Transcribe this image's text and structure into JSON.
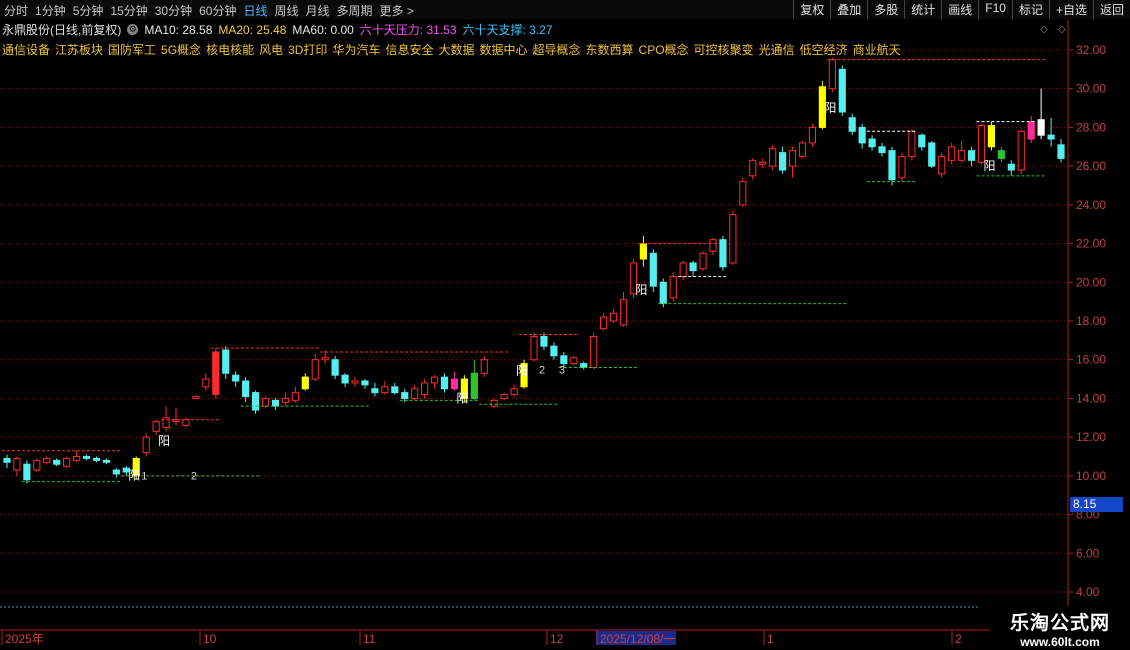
{
  "toolbar": {
    "tabs": [
      "分时",
      "1分钟",
      "5分钟",
      "15分钟",
      "30分钟",
      "60分钟",
      "日线",
      "周线",
      "月线",
      "多周期",
      "更多 >"
    ],
    "active_tab": "日线",
    "right_buttons": [
      "复权",
      "叠加",
      "多股",
      "统计",
      "画线",
      "F10",
      "标记",
      "+自选",
      "返回"
    ]
  },
  "info": {
    "title": "永鼎股份(日线,前复权)",
    "ma10": "MA10: 28.58",
    "ma20": "MA20: 25.48",
    "ma60": "MA60: 0.00",
    "pressure": "六十天压力: 31.53",
    "support": "六十天支撑: 3.27"
  },
  "concepts": [
    "通信设备",
    "江苏板块",
    "国防军工",
    "5G概念",
    "核电核能",
    "风电",
    "3D打印",
    "华为汽车",
    "信息安全",
    "大数据",
    "数据中心",
    "超导概念",
    "东数西算",
    "CPO概念",
    "可控核聚变",
    "光通信",
    "低空经济",
    "商业航天"
  ],
  "colors": {
    "up_candle": "#ff2a2a",
    "down_candle": "#54f0f0",
    "yellow": "#ffff00",
    "magenta": "#ff2a9a",
    "green": "#2ec42e",
    "grid": "#8b1a1a",
    "ma10": "#ffffff",
    "ma20": "#f0d040",
    "pressure": "#ff50ff",
    "support": "#40c0ff"
  },
  "axis": {
    "y_labels": [
      "32.00",
      "30.00",
      "28.00",
      "26.00",
      "24.00",
      "22.00",
      "20.00",
      "18.00",
      "16.00",
      "14.00",
      "12.00",
      "10.00",
      "8.00",
      "6.00",
      "4.00"
    ],
    "y_values": [
      32,
      30,
      28,
      26,
      24,
      22,
      20,
      18,
      16,
      14,
      12,
      10,
      8,
      6,
      4
    ],
    "current_price": "8.15",
    "date_labels": [
      "2025年",
      "10",
      "11",
      "12",
      "2025/12/08/一",
      "1",
      "2"
    ]
  },
  "annotations": {
    "yang": "阳",
    "nums": [
      "1",
      "2",
      "2",
      "3"
    ]
  },
  "watermark": {
    "line1": "乐淘公式网",
    "line2": "www.60lt.com"
  },
  "chart_data": {
    "type": "candlestick",
    "ylim": [
      4,
      32
    ],
    "candles": [
      {
        "o": 10.9,
        "c": 10.7,
        "h": 11.1,
        "l": 10.4
      },
      {
        "o": 10.3,
        "c": 10.9,
        "h": 11.0,
        "l": 10.0
      },
      {
        "o": 10.6,
        "c": 9.8,
        "h": 10.8,
        "l": 9.6
      },
      {
        "o": 10.3,
        "c": 10.8,
        "h": 10.9,
        "l": 10.2
      },
      {
        "o": 10.7,
        "c": 10.9,
        "h": 11.0,
        "l": 10.6
      },
      {
        "o": 10.8,
        "c": 10.6,
        "h": 10.9,
        "l": 10.5
      },
      {
        "o": 10.5,
        "c": 10.9,
        "h": 11.0,
        "l": 10.4
      },
      {
        "o": 10.8,
        "c": 11.0,
        "h": 11.3,
        "l": 10.7
      },
      {
        "o": 11.0,
        "c": 10.9,
        "h": 11.1,
        "l": 10.8
      },
      {
        "o": 10.9,
        "c": 10.8,
        "h": 11.0,
        "l": 10.7
      },
      {
        "o": 10.8,
        "c": 10.7,
        "h": 10.9,
        "l": 10.6
      },
      {
        "o": 10.3,
        "c": 10.1,
        "h": 10.4,
        "l": 9.9
      },
      {
        "o": 10.4,
        "c": 10.2,
        "h": 10.5,
        "l": 10.0
      },
      {
        "o": 10.0,
        "c": 10.9,
        "h": 11.0,
        "l": 9.8
      },
      {
        "o": 11.2,
        "c": 12.0,
        "h": 12.2,
        "l": 11.0
      },
      {
        "o": 12.3,
        "c": 12.8,
        "h": 12.9,
        "l": 12.1
      },
      {
        "o": 12.5,
        "c": 13.0,
        "h": 13.6,
        "l": 12.3
      },
      {
        "o": 12.8,
        "c": 12.9,
        "h": 13.5,
        "l": 12.6
      },
      {
        "o": 12.6,
        "c": 12.9,
        "h": 13.0,
        "l": 12.5
      },
      {
        "o": 14.0,
        "c": 14.1,
        "h": 14.2,
        "l": 14.0
      },
      {
        "o": 14.6,
        "c": 15.0,
        "h": 15.3,
        "l": 14.4
      },
      {
        "o": 14.2,
        "c": 16.4,
        "h": 16.6,
        "l": 14.0
      },
      {
        "o": 16.5,
        "c": 15.3,
        "h": 16.7,
        "l": 15.0
      },
      {
        "o": 15.2,
        "c": 14.9,
        "h": 15.4,
        "l": 14.6
      },
      {
        "o": 14.9,
        "c": 14.1,
        "h": 15.1,
        "l": 13.8
      },
      {
        "o": 14.3,
        "c": 13.4,
        "h": 14.4,
        "l": 13.2
      },
      {
        "o": 13.6,
        "c": 14.0,
        "h": 14.1,
        "l": 13.5
      },
      {
        "o": 13.9,
        "c": 13.6,
        "h": 14.0,
        "l": 13.4
      },
      {
        "o": 13.8,
        "c": 14.0,
        "h": 14.3,
        "l": 13.6
      },
      {
        "o": 13.9,
        "c": 14.3,
        "h": 14.6,
        "l": 13.8
      },
      {
        "o": 14.5,
        "c": 15.1,
        "h": 15.3,
        "l": 14.4
      },
      {
        "o": 15.0,
        "c": 16.0,
        "h": 16.3,
        "l": 14.9
      },
      {
        "o": 16.0,
        "c": 16.1,
        "h": 16.5,
        "l": 15.8
      },
      {
        "o": 16.0,
        "c": 15.2,
        "h": 16.2,
        "l": 15.0
      },
      {
        "o": 15.2,
        "c": 14.8,
        "h": 15.3,
        "l": 14.6
      },
      {
        "o": 14.8,
        "c": 14.9,
        "h": 15.1,
        "l": 14.6
      },
      {
        "o": 14.9,
        "c": 14.7,
        "h": 15.0,
        "l": 14.5
      },
      {
        "o": 14.5,
        "c": 14.3,
        "h": 14.8,
        "l": 14.1
      },
      {
        "o": 14.3,
        "c": 14.6,
        "h": 14.9,
        "l": 14.2
      },
      {
        "o": 14.6,
        "c": 14.3,
        "h": 14.8,
        "l": 14.2
      },
      {
        "o": 14.3,
        "c": 14.0,
        "h": 14.5,
        "l": 13.8
      },
      {
        "o": 14.0,
        "c": 14.5,
        "h": 14.7,
        "l": 13.9
      },
      {
        "o": 14.2,
        "c": 14.8,
        "h": 15.0,
        "l": 14.0
      },
      {
        "o": 14.8,
        "c": 15.1,
        "h": 15.2,
        "l": 14.5
      },
      {
        "o": 15.1,
        "c": 14.5,
        "h": 15.3,
        "l": 14.3
      },
      {
        "o": 14.5,
        "c": 15.0,
        "h": 15.4,
        "l": 14.4
      },
      {
        "o": 15.0,
        "c": 14.0,
        "h": 15.2,
        "l": 13.8
      },
      {
        "o": 14.0,
        "c": 15.3,
        "h": 16.0,
        "l": 13.9
      },
      {
        "o": 15.3,
        "c": 16.0,
        "h": 16.2,
        "l": 15.1
      },
      {
        "o": 13.6,
        "c": 13.9,
        "h": 14.0,
        "l": 13.5
      },
      {
        "o": 14.0,
        "c": 14.2,
        "h": 14.3,
        "l": 13.9
      },
      {
        "o": 14.2,
        "c": 14.5,
        "h": 14.7,
        "l": 14.1
      },
      {
        "o": 14.6,
        "c": 15.8,
        "h": 16.0,
        "l": 14.5
      },
      {
        "o": 16.0,
        "c": 17.2,
        "h": 17.4,
        "l": 15.9
      },
      {
        "o": 17.2,
        "c": 16.7,
        "h": 17.4,
        "l": 16.5
      },
      {
        "o": 16.7,
        "c": 16.2,
        "h": 16.9,
        "l": 16.0
      },
      {
        "o": 16.2,
        "c": 15.8,
        "h": 16.4,
        "l": 15.6
      },
      {
        "o": 15.8,
        "c": 16.1,
        "h": 16.2,
        "l": 15.7
      },
      {
        "o": 15.8,
        "c": 15.6,
        "h": 15.9,
        "l": 15.5
      },
      {
        "o": 15.6,
        "c": 17.2,
        "h": 17.4,
        "l": 15.5
      },
      {
        "o": 17.6,
        "c": 18.2,
        "h": 18.4,
        "l": 17.5
      },
      {
        "o": 18.0,
        "c": 18.4,
        "h": 18.6,
        "l": 17.9
      },
      {
        "o": 17.8,
        "c": 19.1,
        "h": 19.5,
        "l": 17.7
      },
      {
        "o": 19.4,
        "c": 21.0,
        "h": 21.2,
        "l": 19.2
      },
      {
        "o": 21.2,
        "c": 22.0,
        "h": 22.4,
        "l": 20.8
      },
      {
        "o": 21.5,
        "c": 19.8,
        "h": 21.7,
        "l": 19.5
      },
      {
        "o": 20.0,
        "c": 18.9,
        "h": 20.2,
        "l": 18.7
      },
      {
        "o": 19.2,
        "c": 20.3,
        "h": 20.5,
        "l": 19.0
      },
      {
        "o": 20.3,
        "c": 21.0,
        "h": 21.1,
        "l": 20.1
      },
      {
        "o": 21.0,
        "c": 20.6,
        "h": 21.1,
        "l": 20.3
      },
      {
        "o": 20.7,
        "c": 21.5,
        "h": 21.6,
        "l": 20.6
      },
      {
        "o": 21.6,
        "c": 22.2,
        "h": 22.3,
        "l": 21.4
      },
      {
        "o": 22.2,
        "c": 20.8,
        "h": 22.4,
        "l": 20.6
      },
      {
        "o": 21.0,
        "c": 23.5,
        "h": 23.7,
        "l": 20.9
      },
      {
        "o": 24.0,
        "c": 25.2,
        "h": 25.4,
        "l": 23.9
      },
      {
        "o": 25.5,
        "c": 26.3,
        "h": 26.4,
        "l": 25.3
      },
      {
        "o": 26.1,
        "c": 26.2,
        "h": 26.4,
        "l": 25.9
      },
      {
        "o": 26.0,
        "c": 26.9,
        "h": 27.1,
        "l": 25.8
      },
      {
        "o": 26.7,
        "c": 25.8,
        "h": 27.0,
        "l": 25.6
      },
      {
        "o": 26.0,
        "c": 26.8,
        "h": 27.0,
        "l": 25.4
      },
      {
        "o": 26.5,
        "c": 27.2,
        "h": 27.3,
        "l": 26.4
      },
      {
        "o": 27.2,
        "c": 28.0,
        "h": 28.2,
        "l": 27.0
      },
      {
        "o": 28.0,
        "c": 30.1,
        "h": 30.4,
        "l": 27.9
      },
      {
        "o": 30.0,
        "c": 31.5,
        "h": 31.6,
        "l": 29.8
      },
      {
        "o": 31.0,
        "c": 28.8,
        "h": 31.2,
        "l": 28.6
      },
      {
        "o": 28.5,
        "c": 27.8,
        "h": 28.7,
        "l": 27.6
      },
      {
        "o": 28.0,
        "c": 27.2,
        "h": 28.2,
        "l": 26.9
      },
      {
        "o": 27.4,
        "c": 27.0,
        "h": 27.6,
        "l": 26.8
      },
      {
        "o": 27.0,
        "c": 26.7,
        "h": 27.2,
        "l": 26.5
      },
      {
        "o": 26.8,
        "c": 25.3,
        "h": 27.0,
        "l": 25.0
      },
      {
        "o": 25.4,
        "c": 26.5,
        "h": 26.7,
        "l": 25.2
      },
      {
        "o": 26.5,
        "c": 27.8,
        "h": 27.9,
        "l": 26.3
      },
      {
        "o": 27.6,
        "c": 27.0,
        "h": 27.7,
        "l": 26.8
      },
      {
        "o": 27.2,
        "c": 26.0,
        "h": 27.3,
        "l": 25.9
      },
      {
        "o": 25.6,
        "c": 26.5,
        "h": 26.7,
        "l": 25.4
      },
      {
        "o": 26.3,
        "c": 27.0,
        "h": 27.2,
        "l": 26.1
      },
      {
        "o": 26.3,
        "c": 26.8,
        "h": 27.3,
        "l": 26.2
      },
      {
        "o": 26.8,
        "c": 26.3,
        "h": 27.0,
        "l": 26.0
      },
      {
        "o": 26.2,
        "c": 28.1,
        "h": 28.2,
        "l": 26.1
      },
      {
        "o": 28.1,
        "c": 27.0,
        "h": 28.3,
        "l": 26.8
      },
      {
        "o": 26.4,
        "c": 26.8,
        "h": 27.0,
        "l": 26.2
      },
      {
        "o": 26.1,
        "c": 25.8,
        "h": 26.3,
        "l": 25.5
      },
      {
        "o": 25.8,
        "c": 27.8,
        "h": 27.9,
        "l": 25.6
      },
      {
        "o": 27.4,
        "c": 28.3,
        "h": 28.6,
        "l": 27.2
      },
      {
        "o": 28.4,
        "c": 27.6,
        "h": 30.0,
        "l": 27.4
      },
      {
        "o": 27.6,
        "c": 27.4,
        "h": 28.5,
        "l": 27.0
      },
      {
        "o": 27.1,
        "c": 26.4,
        "h": 27.4,
        "l": 26.2
      }
    ]
  }
}
